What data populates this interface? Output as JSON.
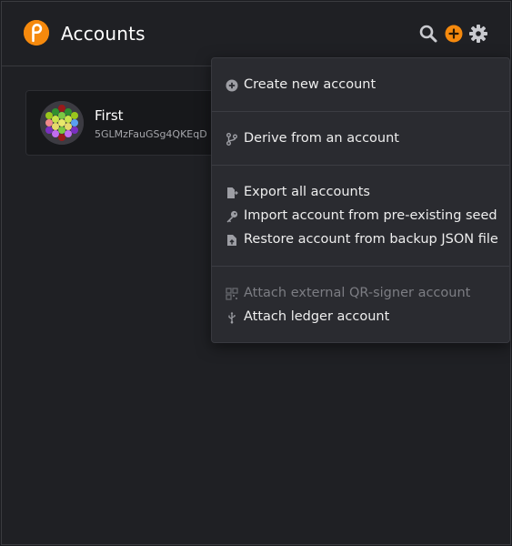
{
  "header": {
    "title": "Accounts",
    "logo_icon": "polkadot-logo-icon",
    "actions": [
      "search-icon",
      "add-icon",
      "settings-icon"
    ],
    "accent_color": "#f5890d"
  },
  "account": {
    "name": "First",
    "address": "5GLMzFauGSg4QKEqD"
  },
  "menu": {
    "groups": [
      {
        "items": [
          {
            "label": "Create new account",
            "icon": "plus-circle-icon",
            "enabled": true
          }
        ]
      },
      {
        "items": [
          {
            "label": "Derive from an account",
            "icon": "branch-icon",
            "enabled": true
          }
        ]
      },
      {
        "items": [
          {
            "label": "Export all accounts",
            "icon": "file-export-icon",
            "enabled": true
          },
          {
            "label": "Import account from pre-existing seed",
            "icon": "key-icon",
            "enabled": true
          },
          {
            "label": "Restore account from backup JSON file",
            "icon": "file-upload-icon",
            "enabled": true
          }
        ]
      },
      {
        "items": [
          {
            "label": "Attach external QR-signer account",
            "icon": "qrcode-icon",
            "enabled": false
          },
          {
            "label": "Attach ledger account",
            "icon": "usb-icon",
            "enabled": true
          }
        ]
      }
    ]
  }
}
